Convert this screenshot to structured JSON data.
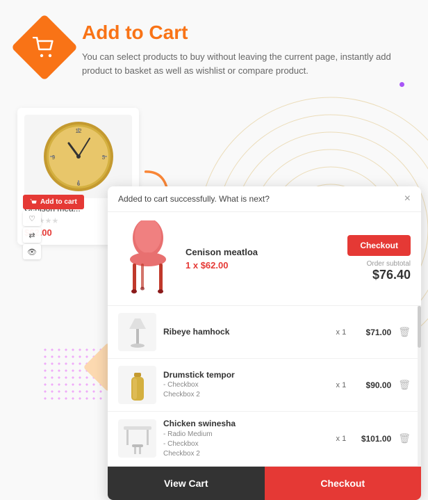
{
  "header": {
    "title": "Add to Cart",
    "description": "You can select products to buy without leaving the current page, instantly add product to basket as well as wishlist or compare product.",
    "icon": "cart-icon"
  },
  "product_card": {
    "name": "Cenison mea...",
    "price": "$62.00",
    "add_to_cart_label": "Add to cart",
    "stars": "★★★★★"
  },
  "popup": {
    "header_text": "Added to cart successfully. What is next?",
    "close_label": "×",
    "checkout_label": "Checkout",
    "product_name": "Cenison meatloa",
    "product_qty_label": "1 x",
    "product_price": "$62.00",
    "subtotal_label": "Order subtotal",
    "subtotal_value": "$76.40",
    "cart_items": [
      {
        "name": "Ribeye hamhock",
        "variants": "",
        "qty": "x 1",
        "price": "$71.00"
      },
      {
        "name": "Drumstick tempor",
        "variants": "- Checkbox\nCheckbox 2",
        "qty": "x 1",
        "price": "$90.00"
      },
      {
        "name": "Chicken swinesha",
        "variants": "- Radio Medium\n- Checkbox\nCheckbox 2",
        "qty": "x 1",
        "price": "$101.00"
      }
    ],
    "view_cart_label": "View Cart",
    "footer_checkout_label": "Checkout"
  },
  "colors": {
    "accent_orange": "#f97316",
    "accent_red": "#e53935",
    "dark_btn": "#333333"
  }
}
